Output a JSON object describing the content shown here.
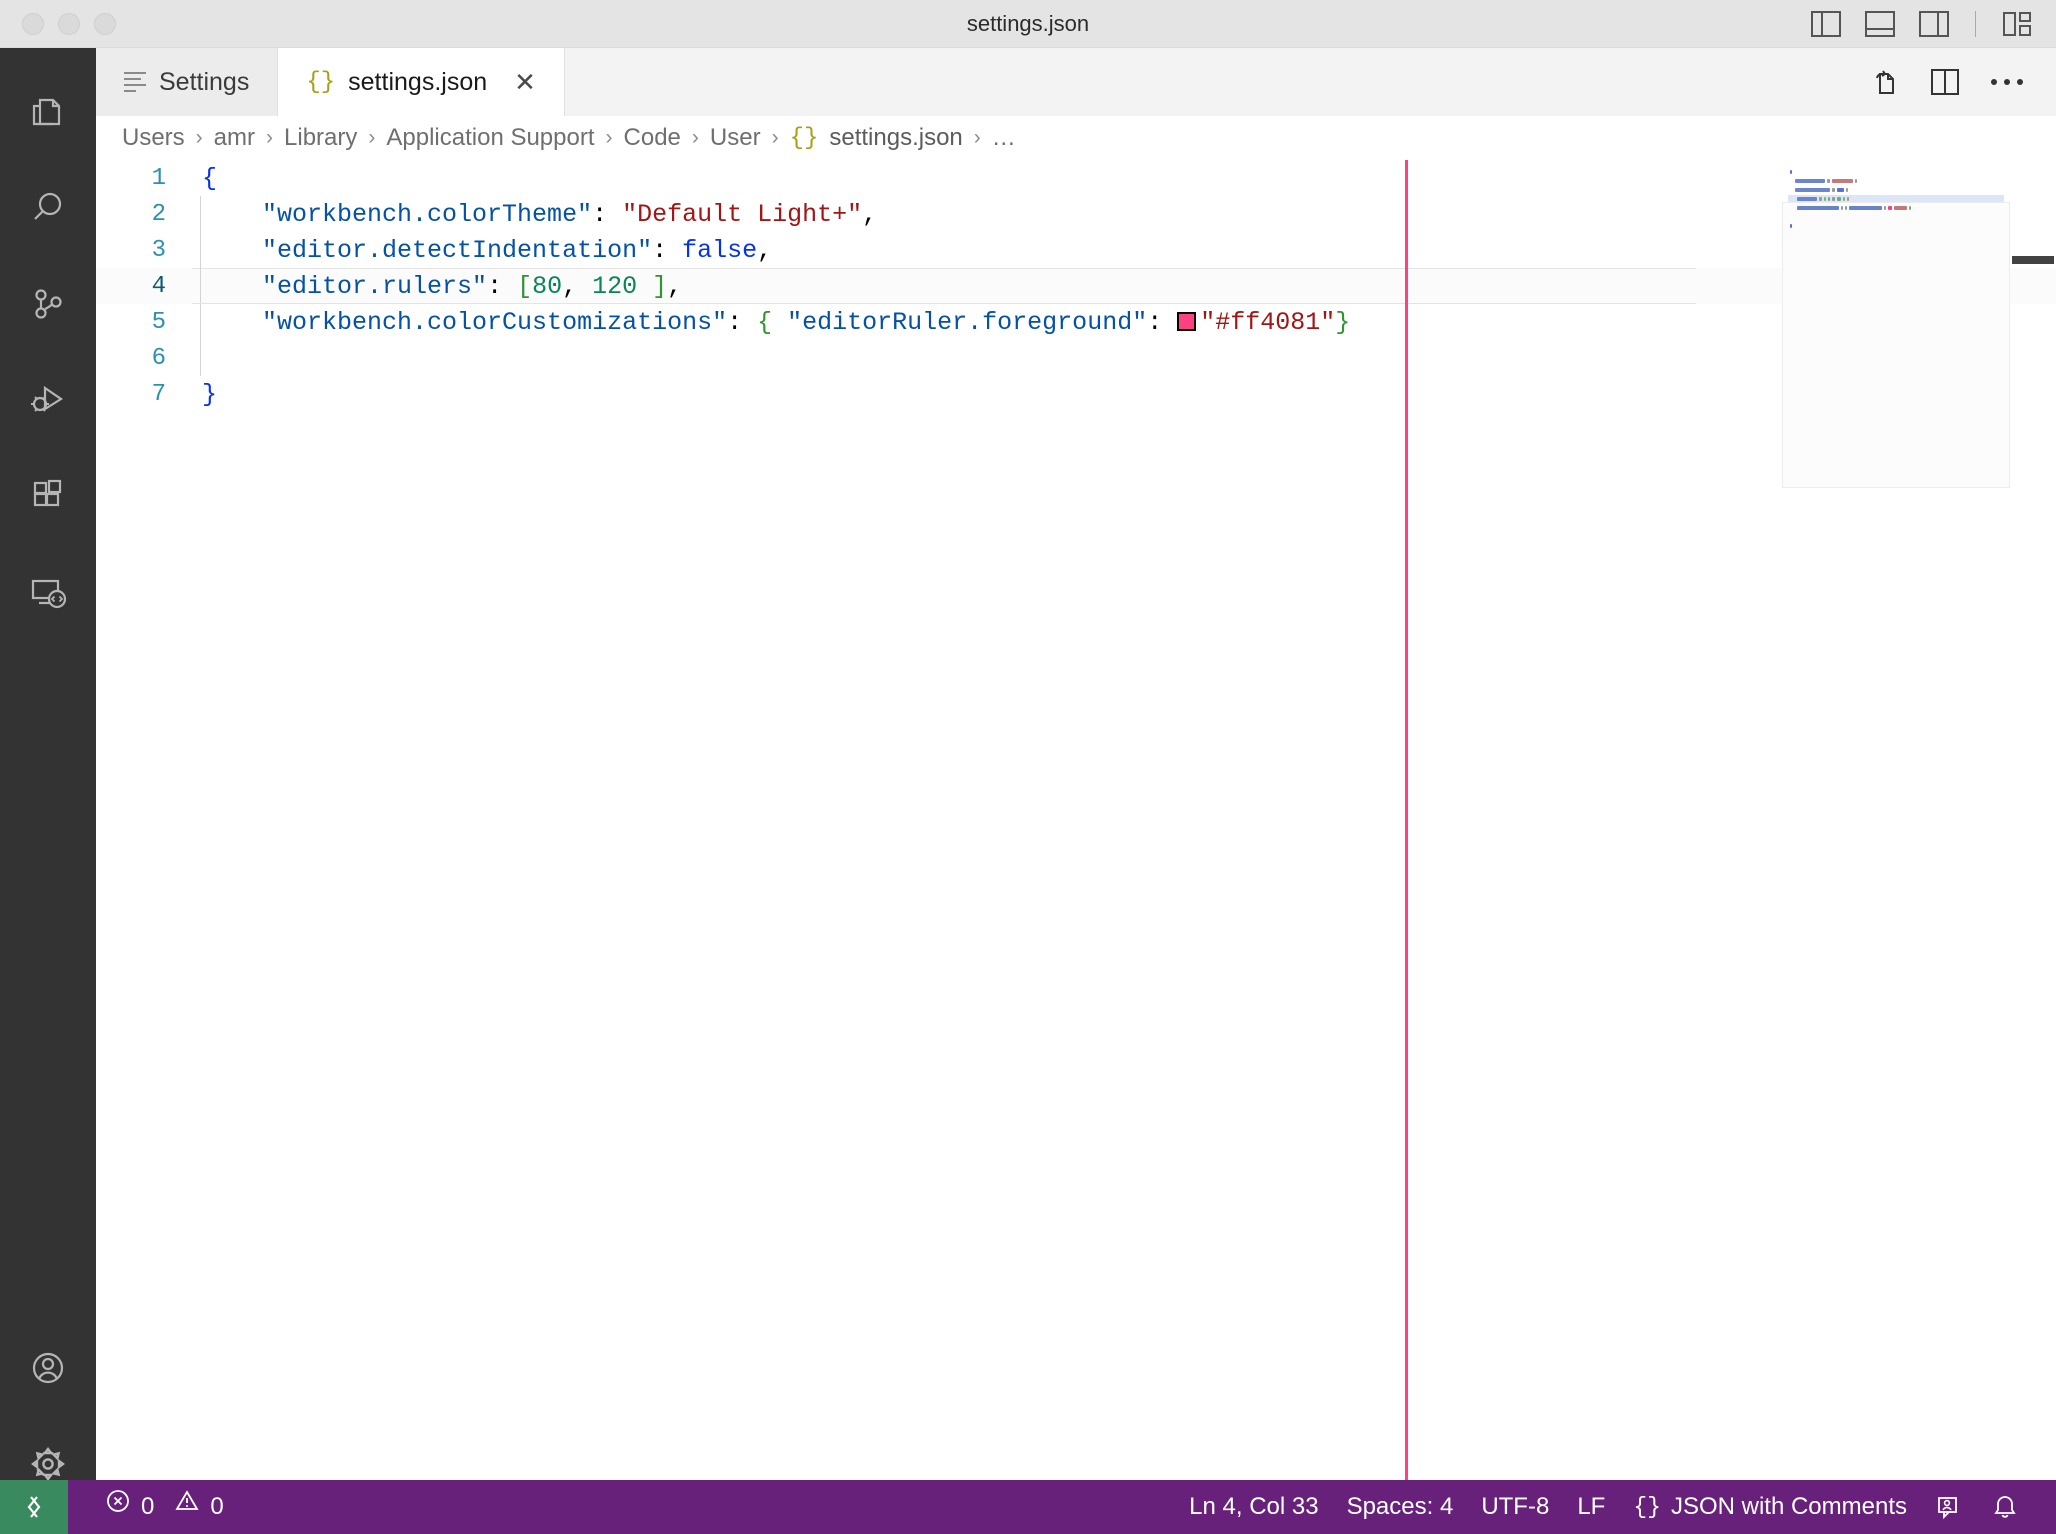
{
  "window": {
    "title": "settings.json",
    "traffic_lights": [
      "close",
      "minimize",
      "zoom"
    ],
    "layout_icons": [
      "toggle-primary-sidebar",
      "toggle-panel",
      "toggle-secondary-sidebar",
      "customize-layout"
    ]
  },
  "activity_bar": {
    "top_items": [
      {
        "name": "explorer",
        "label": "Explorer"
      },
      {
        "name": "search",
        "label": "Search"
      },
      {
        "name": "source-control",
        "label": "Source Control"
      },
      {
        "name": "run-and-debug",
        "label": "Run and Debug"
      },
      {
        "name": "extensions",
        "label": "Extensions"
      },
      {
        "name": "remote-explorer",
        "label": "Remote Explorer"
      }
    ],
    "bottom_items": [
      {
        "name": "accounts",
        "label": "Accounts"
      },
      {
        "name": "manage",
        "label": "Manage"
      }
    ]
  },
  "tabs": [
    {
      "label": "Settings",
      "icon": "settings-lines-icon",
      "active": false,
      "closable": false
    },
    {
      "label": "settings.json",
      "icon": "json-braces-icon",
      "active": true,
      "closable": true,
      "close_label": "✕"
    }
  ],
  "tab_actions": [
    {
      "name": "open-changes-icon"
    },
    {
      "name": "split-editor-right-icon"
    },
    {
      "name": "more-actions-icon"
    }
  ],
  "breadcrumb": {
    "separator": "›",
    "items": [
      "Users",
      "amr",
      "Library",
      "Application Support",
      "Code",
      "User",
      "settings.json",
      "…"
    ],
    "file_index": 6,
    "file_icon": "{}"
  },
  "editor": {
    "language": "JSON with Comments",
    "current_line": 4,
    "rulers": [
      {
        "column": 80,
        "color": "#ff4081"
      },
      {
        "column": 120,
        "color": "#ff4081"
      }
    ],
    "lines": [
      {
        "num": 1,
        "tokens": [
          {
            "t": "{",
            "c": "br"
          }
        ]
      },
      {
        "num": 2,
        "tokens": [
          {
            "t": "    ",
            "c": "p"
          },
          {
            "t": "\"workbench.colorTheme\"",
            "c": "k"
          },
          {
            "t": ": ",
            "c": "p"
          },
          {
            "t": "\"Default Light+\"",
            "c": "s"
          },
          {
            "t": ",",
            "c": "p"
          }
        ]
      },
      {
        "num": 3,
        "tokens": [
          {
            "t": "    ",
            "c": "p"
          },
          {
            "t": "\"editor.detectIndentation\"",
            "c": "k"
          },
          {
            "t": ": ",
            "c": "p"
          },
          {
            "t": "false",
            "c": "br"
          },
          {
            "t": ",",
            "c": "p"
          }
        ]
      },
      {
        "num": 4,
        "tokens": [
          {
            "t": "    ",
            "c": "p"
          },
          {
            "t": "\"editor.rulers\"",
            "c": "k"
          },
          {
            "t": ": ",
            "c": "p"
          },
          {
            "t": "[",
            "c": "brg"
          },
          {
            "t": "80",
            "c": "n"
          },
          {
            "t": ", ",
            "c": "p"
          },
          {
            "t": "120",
            "c": "n"
          },
          {
            "t": " ",
            "c": "p"
          },
          {
            "t": "]",
            "c": "brg"
          },
          {
            "t": ",",
            "c": "p"
          }
        ]
      },
      {
        "num": 5,
        "tokens": [
          {
            "t": "    ",
            "c": "p"
          },
          {
            "t": "\"workbench.colorCustomizations\"",
            "c": "k"
          },
          {
            "t": ": ",
            "c": "p"
          },
          {
            "t": "{",
            "c": "brg"
          },
          {
            "t": " ",
            "c": "p"
          },
          {
            "t": "\"editorRuler.foreground\"",
            "c": "k"
          },
          {
            "t": ": ",
            "c": "p"
          },
          {
            "t": "@SWATCH@",
            "c": "swatch",
            "color": "#ff4081"
          },
          {
            "t": "\"#ff4081\"",
            "c": "s"
          },
          {
            "t": "}",
            "c": "brg"
          }
        ]
      },
      {
        "num": 6,
        "tokens": []
      },
      {
        "num": 7,
        "tokens": [
          {
            "t": "}",
            "c": "br"
          }
        ]
      }
    ]
  },
  "status_bar": {
    "remote_icon": "remote-window-icon",
    "problems": {
      "errors": "0",
      "warnings": "0",
      "error_icon": "error-circle-icon",
      "warning_icon": "warning-triangle-icon"
    },
    "right_items": [
      {
        "name": "cursor-position",
        "label": "Ln 4, Col 33"
      },
      {
        "name": "indentation",
        "label": "Spaces: 4"
      },
      {
        "name": "encoding",
        "label": "UTF-8"
      },
      {
        "name": "eol",
        "label": "LF"
      },
      {
        "name": "language-mode",
        "label": "JSON with Comments",
        "prefix": "{}"
      }
    ],
    "right_icons": [
      {
        "name": "feedback-icon"
      },
      {
        "name": "notifications-bell-icon"
      }
    ],
    "background": "#68217a",
    "remote_background": "#3a8a5f"
  },
  "colors": {
    "key": "#0451a5",
    "string": "#a31515",
    "number": "#098658",
    "brace_top": "#0431fa",
    "brace_nested": "#319331",
    "ruler": "#ff4081",
    "line_number": "#2b91af"
  }
}
